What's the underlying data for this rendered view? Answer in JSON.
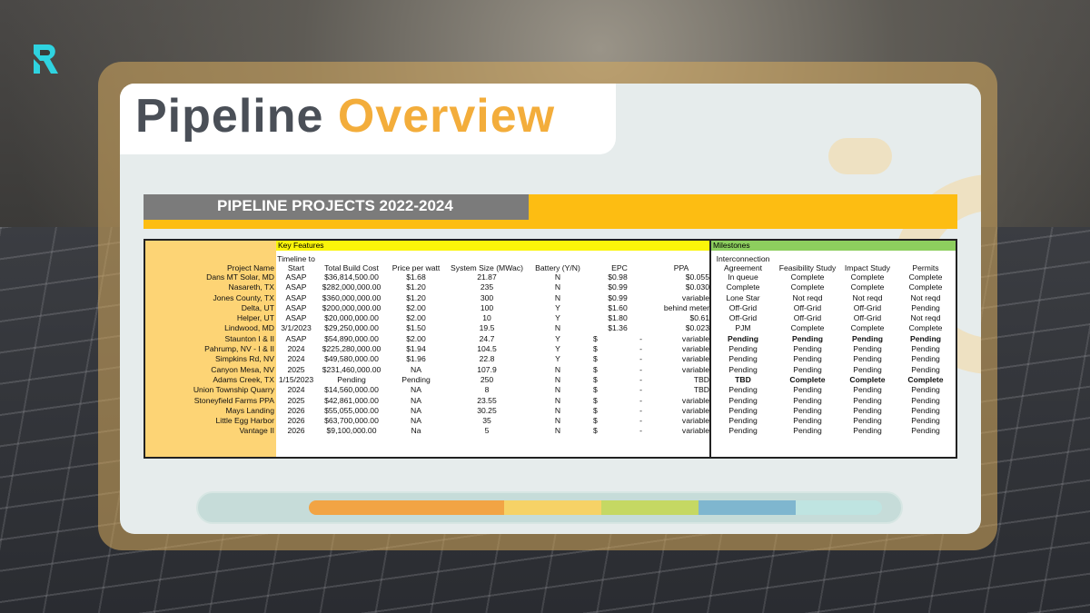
{
  "slide": {
    "title_word1": "Pipeline",
    "title_word2": "Overview",
    "banner": "PIPELINE PROJECTS 2022-2024"
  },
  "logo": {
    "icon": "r-logo-icon",
    "color": "#2fd3e0"
  },
  "colors": {
    "accent_orange": "#f3ad3b",
    "title_gray": "#4a4f57",
    "banner_yellow": "#fdbd12",
    "key_features": "#fbf50a",
    "milestones": "#8dce5e",
    "name_column": "#fdd475"
  },
  "table": {
    "group_key_features": "Key Features",
    "group_milestones": "Milestones",
    "headers": {
      "name": "Project Name",
      "timeline": "Timeline to Start",
      "cost": "Total Build Cost",
      "ppw": "Price per watt",
      "size": "System Size (MWac)",
      "battery": "Battery (Y/N)",
      "epc": "EPC",
      "ppa": "PPA",
      "interconnection": "Interconnection Agreement",
      "feasibility": "Feasibility Study",
      "impact": "Impact Study",
      "permits": "Permits"
    },
    "rows": [
      {
        "name": "Dans MT Solar, MD",
        "timeline": "ASAP",
        "cost": "$36,814,500.00",
        "ppw": "$1.68",
        "size": "21.87",
        "battery": "N",
        "epc": "$0.98",
        "epc_dash": "",
        "ppa": "$0.055",
        "ia": "In queue",
        "fs": "Complete",
        "is": "Complete",
        "permits": "Complete"
      },
      {
        "name": "Nasareth, TX",
        "timeline": "ASAP",
        "cost": "$282,000,000.00",
        "ppw": "$1.20",
        "size": "235",
        "battery": "N",
        "epc": "$0.99",
        "epc_dash": "",
        "ppa": "$0.030",
        "ia": "Complete",
        "fs": "Complete",
        "is": "Complete",
        "permits": "Complete"
      },
      {
        "name": "Jones County, TX",
        "timeline": "ASAP",
        "cost": "$360,000,000.00",
        "ppw": "$1.20",
        "size": "300",
        "battery": "N",
        "epc": "$0.99",
        "epc_dash": "",
        "ppa": "variable",
        "ia": "Lone Star",
        "fs": "Not reqd",
        "is": "Not reqd",
        "permits": "Not reqd"
      },
      {
        "name": "Delta, UT",
        "timeline": "ASAP",
        "cost": "$200,000,000.00",
        "ppw": "$2.00",
        "size": "100",
        "battery": "Y",
        "epc": "$1.60",
        "epc_dash": "",
        "ppa": "behind meter",
        "ia": "Off-Grid",
        "fs": "Off-Grid",
        "is": "Off-Grid",
        "permits": "Pending"
      },
      {
        "name": "Helper, UT",
        "timeline": "ASAP",
        "cost": "$20,000,000.00",
        "ppw": "$2.00",
        "size": "10",
        "battery": "Y",
        "epc": "$1.80",
        "epc_dash": "",
        "ppa": "$0.61",
        "ia": "Off-Grid",
        "fs": "Off-Grid",
        "is": "Off-Grid",
        "permits": "Not reqd"
      },
      {
        "name": "Lindwood, MD",
        "timeline": "3/1/2023",
        "cost": "$29,250,000.00",
        "ppw": "$1.50",
        "size": "19.5",
        "battery": "N",
        "epc": "$1.36",
        "epc_dash": "",
        "ppa": "$0.023",
        "ia": "PJM",
        "fs": "Complete",
        "is": "Complete",
        "permits": "Complete"
      },
      {
        "name": "Staunton I & II",
        "timeline": "ASAP",
        "cost": "$54,890,000.00",
        "ppw": "$2.00",
        "size": "24.7",
        "battery": "Y",
        "epc": "$",
        "epc_dash": "-",
        "ppa": "variable",
        "ia": "Pending",
        "fs": "Pending",
        "is": "Pending",
        "permits": "Pending"
      },
      {
        "name": "Pahrump, NV - I & II",
        "timeline": "2024",
        "cost": "$225,280,000.00",
        "ppw": "$1.94",
        "size": "104.5",
        "battery": "Y",
        "epc": "$",
        "epc_dash": "-",
        "ppa": "variable",
        "ia": "Pending",
        "fs": "Pending",
        "is": "Pending",
        "permits": "Pending"
      },
      {
        "name": "Simpkins Rd, NV",
        "timeline": "2024",
        "cost": "$49,580,000.00",
        "ppw": "$1.96",
        "size": "22.8",
        "battery": "Y",
        "epc": "$",
        "epc_dash": "-",
        "ppa": "variable",
        "ia": "Pending",
        "fs": "Pending",
        "is": "Pending",
        "permits": "Pending"
      },
      {
        "name": "Canyon Mesa, NV",
        "timeline": "2025",
        "cost": "$231,460,000.00",
        "ppw": "NA",
        "size": "107.9",
        "battery": "N",
        "epc": "$",
        "epc_dash": "-",
        "ppa": "variable",
        "ia": "Pending",
        "fs": "Pending",
        "is": "Pending",
        "permits": "Pending"
      },
      {
        "name": "Adams Creek, TX",
        "timeline": "1/15/2023",
        "cost": "Pending",
        "ppw": "Pending",
        "size": "250",
        "battery": "N",
        "epc": "$",
        "epc_dash": "-",
        "ppa": "TBD",
        "ia": "TBD",
        "fs": "Complete",
        "is": "Complete",
        "permits": "Complete"
      },
      {
        "name": "Union Township Quarry",
        "timeline": "2024",
        "cost": "$14,560,000.00",
        "ppw": "NA",
        "size": "8",
        "battery": "N",
        "epc": "$",
        "epc_dash": "-",
        "ppa": "TBD",
        "ia": "Pending",
        "fs": "Pending",
        "is": "Pending",
        "permits": "Pending"
      },
      {
        "name": "Stoneyfield Farms PPA",
        "timeline": "2025",
        "cost": "$42,861,000.00",
        "ppw": "NA",
        "size": "23.55",
        "battery": "N",
        "epc": "$",
        "epc_dash": "-",
        "ppa": "variable",
        "ia": "Pending",
        "fs": "Pending",
        "is": "Pending",
        "permits": "Pending"
      },
      {
        "name": "Mays Landing",
        "timeline": "2026",
        "cost": "$55,055,000.00",
        "ppw": "NA",
        "size": "30.25",
        "battery": "N",
        "epc": "$",
        "epc_dash": "-",
        "ppa": "variable",
        "ia": "Pending",
        "fs": "Pending",
        "is": "Pending",
        "permits": "Pending"
      },
      {
        "name": "Little Egg Harbor",
        "timeline": "2026",
        "cost": "$63,700,000.00",
        "ppw": "NA",
        "size": "35",
        "battery": "N",
        "epc": "$",
        "epc_dash": "-",
        "ppa": "variable",
        "ia": "Pending",
        "fs": "Pending",
        "is": "Pending",
        "permits": "Pending"
      },
      {
        "name": "Vantage II",
        "timeline": "2026",
        "cost": "$9,100,000.00",
        "ppw": "Na",
        "size": "5",
        "battery": "N",
        "epc": "$",
        "epc_dash": "-",
        "ppa": "variable",
        "ia": "Pending",
        "fs": "Pending",
        "is": "Pending",
        "permits": "Pending"
      }
    ]
  },
  "progress_bar": {
    "segments": [
      {
        "color": "#f2a444",
        "fraction": 0.34
      },
      {
        "color": "#f6d266",
        "fraction": 0.17
      },
      {
        "color": "#c5d863",
        "fraction": 0.17
      },
      {
        "color": "#7fb6cf",
        "fraction": 0.17
      },
      {
        "color": "#bfe4e1",
        "fraction": 0.15
      }
    ]
  }
}
